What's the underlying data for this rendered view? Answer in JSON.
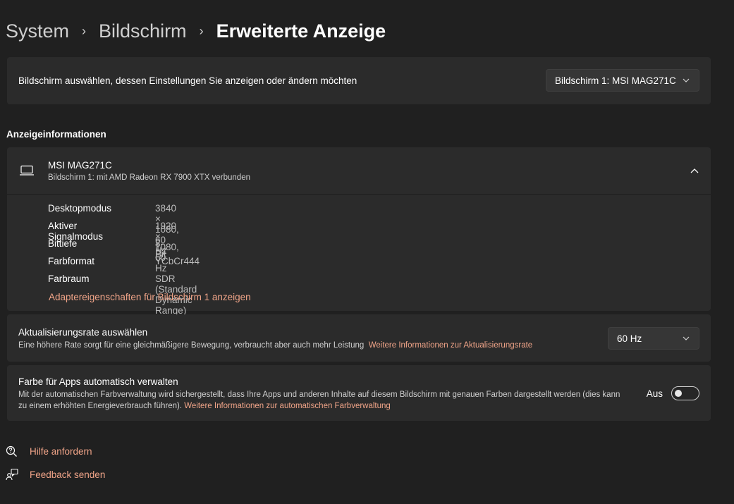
{
  "breadcrumb": {
    "items": [
      "System",
      "Bildschirm"
    ],
    "current": "Erweiterte Anzeige"
  },
  "display_selector": {
    "label": "Bildschirm auswählen, dessen Einstellungen Sie anzeigen oder ändern möchten",
    "selected": "Bildschirm 1: MSI MAG271C",
    "icon": "chevron-down-icon"
  },
  "display_info": {
    "heading": "Anzeigeinformationen",
    "monitor_name": "MSI MAG271C",
    "monitor_subtitle": "Bildschirm 1: mit AMD Radeon RX 7900 XTX verbunden",
    "expanded": true,
    "rows": [
      {
        "label": "Desktopmodus",
        "value": "3840 × 1080, 60 Hz"
      },
      {
        "label": "Aktiver Signalmodus",
        "value": "1920 × 1080, 60 Hz"
      },
      {
        "label": "Bittiefe",
        "value": "8-Bit"
      },
      {
        "label": "Farbformat",
        "value": "YCbCr444"
      },
      {
        "label": "Farbraum",
        "value": "SDR (Standard Dynamic Range)"
      }
    ],
    "adapter_link": "Adaptereigenschaften für Bildschirm 1 anzeigen"
  },
  "refresh_rate": {
    "title": "Aktualisierungsrate auswählen",
    "description": "Eine höhere Rate sorgt für eine gleichmäßigere Bewegung, verbraucht aber auch mehr Leistung",
    "link": "Weitere Informationen zur Aktualisierungsrate",
    "selected": "60 Hz"
  },
  "auto_color": {
    "title": "Farbe für Apps automatisch verwalten",
    "description": "Mit der automatischen Farbverwaltung wird sichergestellt, dass Ihre Apps und anderen Inhalte auf diesem Bildschirm mit genauen Farben dargestellt werden (dies kann zu einem erhöhten Energieverbrauch führen).",
    "link": "Weitere Informationen zur automatischen Farbverwaltung",
    "toggle_label": "Aus",
    "toggle_on": false
  },
  "footer": {
    "help": "Hilfe anfordern",
    "feedback": "Feedback senden"
  },
  "colors": {
    "background": "#202020",
    "card": "#2b2b2b",
    "accent_link": "#f0a488"
  }
}
